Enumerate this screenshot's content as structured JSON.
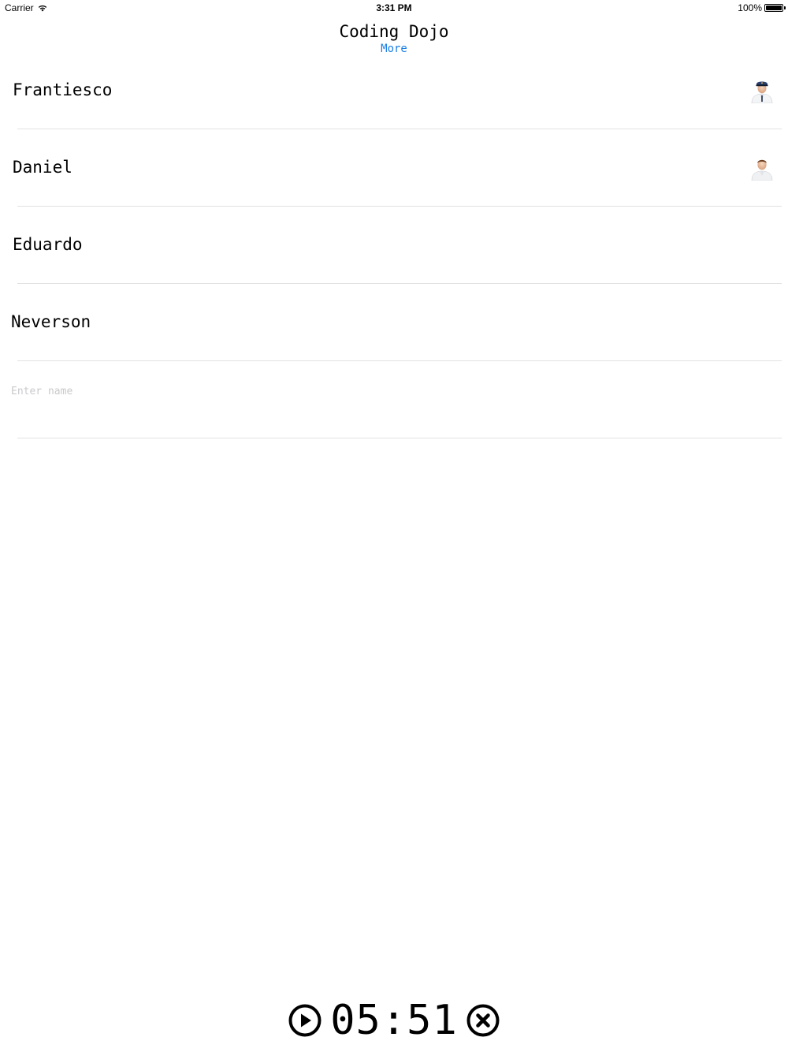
{
  "status_bar": {
    "carrier": "Carrier",
    "time": "3:31 PM",
    "battery": "100%"
  },
  "header": {
    "title": "Coding Dojo",
    "more_label": "More"
  },
  "participants": [
    {
      "name": "Frantiesco",
      "avatar": "pilot-avatar-icon"
    },
    {
      "name": "Daniel",
      "avatar": "user-avatar-icon"
    },
    {
      "name": "Eduardo",
      "avatar": ""
    },
    {
      "name": "Neverson",
      "avatar": ""
    }
  ],
  "new_participant": {
    "placeholder": "Enter name",
    "value": ""
  },
  "timer": {
    "display": "05:51",
    "play_icon": "play-icon",
    "stop_icon": "stop-icon"
  },
  "colors": {
    "accent": "#1a7ee5",
    "separator": "#e2e2e2",
    "placeholder": "#c9c9cd"
  }
}
